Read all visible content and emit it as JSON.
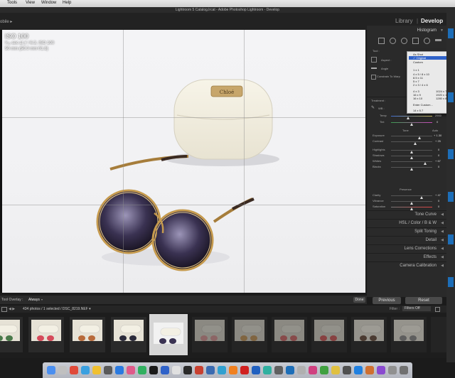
{
  "menubar": {
    "items": [
      "Tools",
      "View",
      "Window",
      "Help"
    ]
  },
  "window": {
    "title": "Lightroom 5 Catalog.lrcat - Adobe Photoshop Lightroom - Develop"
  },
  "modules": {
    "library": "Library",
    "develop": "Develop",
    "left_fragment": "obile ▸"
  },
  "photo_info": {
    "iso": "ISO 100",
    "line1": "¹⁄₂₅ sec at ƒ / 6.3, ISO 100",
    "line2": "50 mm (50.0 mm f/1.8)"
  },
  "right_panel": {
    "histogram": "Histogram",
    "tool_label": "Tool :",
    "aspect_label": "Aspect :",
    "angle_label": "Angle",
    "constrain_label": "Constrain To Warp",
    "treatment_label": "Treatment :",
    "wb_label": "WB :",
    "temp_label": "Temp",
    "tint_label": "Tint",
    "temp_value": "2900",
    "tint_value": "0",
    "tone_label": "Tone",
    "auto_label": "Auto",
    "exposure_label": "Exposure",
    "exposure_value": "+ 1.30",
    "contrast_label": "Contrast",
    "contrast_value": "+ 25",
    "highlights_label": "Highlights",
    "highlights_value": "0",
    "shadows_label": "Shadows",
    "shadows_value": "0",
    "whites_label": "Whites",
    "whites_value": "+ 67",
    "blacks_label": "Blacks",
    "blacks_value": "0",
    "presence_label": "Presence",
    "clarity_label": "Clarity",
    "clarity_value": "+ 47",
    "vibrance_label": "Vibrance",
    "vibrance_value": "0",
    "saturation_label": "Saturation",
    "saturation_value": "0",
    "sections": [
      "Tone Curve",
      "HSL / Color / B & W",
      "Split Toning",
      "Detail",
      "Lens Corrections",
      "Effects",
      "Camera Calibration"
    ]
  },
  "dropdown": {
    "items": [
      "As Shot",
      "Original",
      "Custom",
      "1 x 1",
      "4 x 5 / 8 x 10",
      "8.5 x 11",
      "5 x 7",
      "2 x 3 / 4 x 6",
      "4 x 3",
      "16 x 9",
      "16 x 10",
      "Enter Custom...",
      "14 x 5.7"
    ],
    "right_items": [
      "1024 x 768",
      "1920 x 1080",
      "1280 x 800"
    ],
    "selected": "Original"
  },
  "toolbar": {
    "overlay_label": "Tool Overlay :",
    "overlay_value": "Always",
    "done": "Done",
    "previous": "Previous",
    "reset": "Reset"
  },
  "filmstrip": {
    "info": "434 photos / 1 selected / DSC_8219.NEF ▾",
    "filter_label": "Filter :",
    "filter_value": "Filters Off"
  }
}
